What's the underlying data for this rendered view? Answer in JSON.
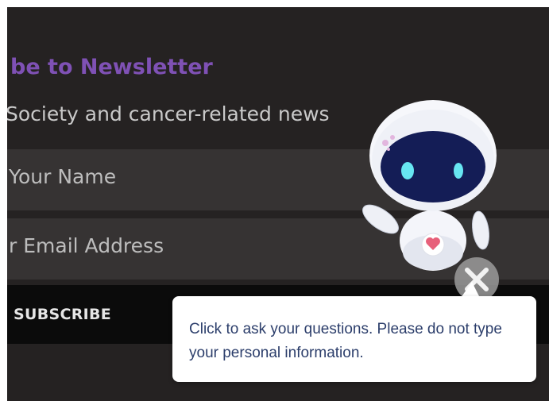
{
  "newsletter": {
    "title": "be to Newsletter",
    "subtitle": "Society and cancer-related news",
    "name_placeholder": "Your Name",
    "email_placeholder": "r Email Address",
    "subscribe_label": "SUBSCRIBE"
  },
  "chatbot": {
    "avatar_icon": "robot-icon",
    "close_icon": "close-icon",
    "tooltip_text": "Click to ask your questions. Please do not type your personal information."
  },
  "colors": {
    "background": "#252222",
    "field": "#363333",
    "title": "#7f51b5",
    "button": "#0b0b0b",
    "tooltip_text": "#2c3e6b"
  }
}
